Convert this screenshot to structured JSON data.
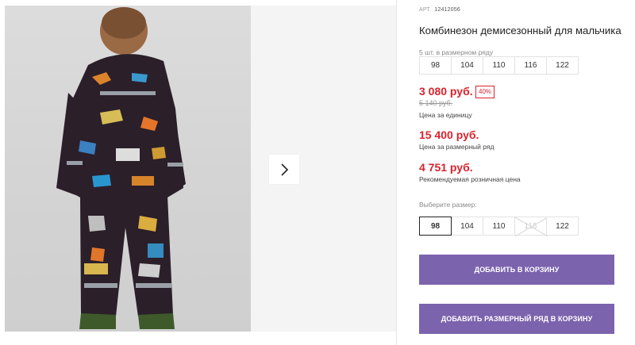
{
  "product": {
    "article_label": "АРТ.",
    "article_number": "12412056",
    "title": "Комбинезон демисезонный для мальчика"
  },
  "size_run": {
    "caption": "5 шт. в размерном ряду",
    "sizes": [
      "98",
      "104",
      "110",
      "116",
      "122"
    ]
  },
  "pricing": {
    "price": "3 080 руб.",
    "discount": "40%",
    "old_price": "5 140 руб.",
    "price_label": "Цена за единицу",
    "run_price": "15 400 руб.",
    "run_price_label": "Цена за размерный ряд",
    "rrp": "4 751 руб.",
    "rrp_label": "Рекомендуемая розничная цена"
  },
  "size_select": {
    "caption": "Выберите размер:",
    "sizes": [
      "98",
      "104",
      "110",
      "116",
      "122"
    ],
    "selected": "98",
    "unavailable": "116"
  },
  "buttons": {
    "add_to_cart": "Добавить в корзину",
    "add_run_to_cart": "Добавить размерный ряд в корзину"
  },
  "colors": {
    "accent_red": "#d9232d",
    "button_purple": "#7c63ad"
  }
}
